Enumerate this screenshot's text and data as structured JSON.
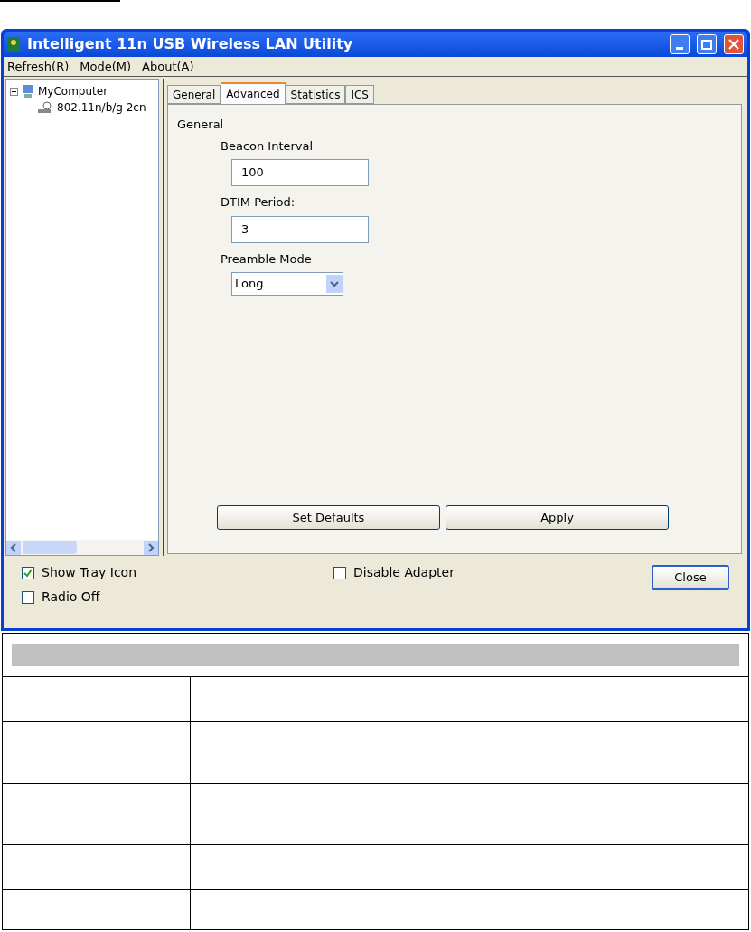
{
  "window": {
    "title": "Intelligent 11n USB Wireless LAN Utility"
  },
  "menu": [
    "Refresh(R)",
    "Mode(M)",
    "About(A)"
  ],
  "tree": [
    {
      "label": "MyComputer",
      "expanded": true,
      "children": [
        {
          "label": "802.11n/b/g 2cn"
        }
      ]
    }
  ],
  "tabs": [
    {
      "label": "General",
      "selected": false
    },
    {
      "label": "Advanced",
      "selected": true
    },
    {
      "label": "Statistics",
      "selected": false
    },
    {
      "label": "ICS",
      "selected": false
    }
  ],
  "section": {
    "title": "General",
    "fields": [
      {
        "kind": "text",
        "label": "Beacon Interval",
        "value": "100"
      },
      {
        "kind": "text",
        "label": "DTIM Period:",
        "value": "3"
      },
      {
        "kind": "select",
        "label": "Preamble Mode",
        "value": "Long"
      }
    ]
  },
  "buttons": [
    "Set Defaults",
    "Apply"
  ],
  "options": [
    {
      "label": "Show Tray Icon",
      "checked": true
    },
    {
      "label": "Radio Off",
      "checked": false
    },
    {
      "label": "Disable Adapter",
      "checked": false
    }
  ],
  "close_button": "Close"
}
